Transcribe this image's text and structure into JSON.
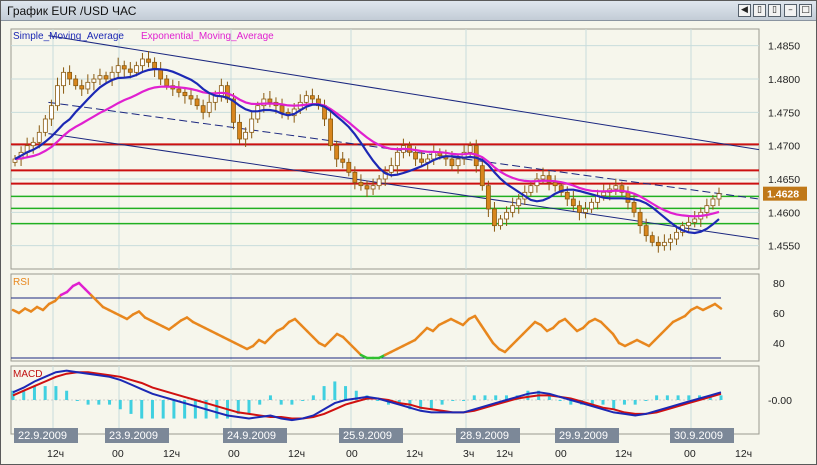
{
  "window": {
    "title": "График EUR /USD  ЧАС",
    "buttons": [
      "◀",
      "▯",
      "▯",
      "–",
      "□",
      "✕"
    ]
  },
  "colors": {
    "background": "#f6f6ec",
    "grid": "#c8dcdc",
    "candle_up": "#ffffff",
    "candle_down": "#d8861e",
    "candle_outline": "#8a5a10",
    "sma": "#1c28b4",
    "ema": "#e020d0",
    "channel": "#1c2880",
    "resistance": "#cc1010",
    "support": "#20b020",
    "rsi": "#e8871e",
    "rsi_overbought": "#e020d0",
    "rsi_oversold": "#30c030",
    "macd": "#1c28b4",
    "signal": "#d01010",
    "histogram": "#40d0e0",
    "price_tag": "#c07818",
    "date_label_bg": "#7c8898"
  },
  "chart_data": [
    {
      "type": "candlestick",
      "name": "EUR/USD hourly",
      "legend": [
        "Simple_Moving_Average",
        "Exponential_Moving_Average"
      ],
      "ylim": [
        1.4515,
        1.4875
      ],
      "y_ticks": [
        "1.4850",
        "1.4800",
        "1.4750",
        "1.4700",
        "1.4650",
        "1.4600",
        "1.4550"
      ],
      "current_price": "1.4628",
      "horizontal_lines": {
        "resistance": [
          1.4702,
          1.4663,
          1.4643
        ],
        "support": [
          1.4624,
          1.4606,
          1.4583
        ]
      },
      "trend_channel": {
        "upper": [
          [
            0.05,
            1.4865
          ],
          [
            1.0,
            1.4694
          ]
        ],
        "middle": [
          [
            0.05,
            1.4765
          ],
          [
            1.0,
            1.462
          ]
        ],
        "lower": [
          [
            0.05,
            1.4718
          ],
          [
            1.0,
            1.456
          ]
        ]
      },
      "close": [
        1.468,
        1.469,
        1.47,
        1.4705,
        1.472,
        1.474,
        1.476,
        1.479,
        1.481,
        1.48,
        1.479,
        1.4785,
        1.4795,
        1.48,
        1.4805,
        1.48,
        1.481,
        1.482,
        1.4815,
        1.481,
        1.482,
        1.483,
        1.4825,
        1.4815,
        1.48,
        1.479,
        1.4785,
        1.478,
        1.4775,
        1.477,
        1.476,
        1.475,
        1.4765,
        1.4775,
        1.479,
        1.477,
        1.4735,
        1.471,
        1.472,
        1.474,
        1.476,
        1.477,
        1.4765,
        1.476,
        1.475,
        1.4745,
        1.4755,
        1.4765,
        1.4775,
        1.477,
        1.476,
        1.474,
        1.47,
        1.468,
        1.4675,
        1.466,
        1.4645,
        1.464,
        1.4635,
        1.464,
        1.465,
        1.466,
        1.467,
        1.469,
        1.47,
        1.469,
        1.468,
        1.4675,
        1.468,
        1.469,
        1.4685,
        1.468,
        1.467,
        1.468,
        1.469,
        1.47,
        1.467,
        1.464,
        1.4605,
        1.458,
        1.459,
        1.46,
        1.461,
        1.462,
        1.463,
        1.464,
        1.465,
        1.4655,
        1.4645,
        1.464,
        1.463,
        1.462,
        1.461,
        1.46,
        1.4605,
        1.4615,
        1.4625,
        1.463,
        1.4635,
        1.464,
        1.463,
        1.4615,
        1.46,
        1.458,
        1.4565,
        1.4555,
        1.455,
        1.4555,
        1.456,
        1.457,
        1.458,
        1.4585,
        1.459,
        1.46,
        1.461,
        1.462,
        1.4628
      ]
    },
    {
      "type": "line",
      "name": "RSI",
      "ylim": [
        28,
        86
      ],
      "y_ticks": [
        "80",
        "60",
        "40"
      ],
      "levels": [
        70,
        30
      ],
      "values": [
        62,
        60,
        63,
        61,
        64,
        62,
        66,
        68,
        72,
        74,
        78,
        80,
        76,
        72,
        68,
        64,
        62,
        60,
        58,
        56,
        59,
        61,
        57,
        55,
        53,
        51,
        49,
        52,
        55,
        57,
        54,
        52,
        50,
        48,
        46,
        44,
        42,
        40,
        38,
        36,
        38,
        42,
        40,
        44,
        48,
        50,
        54,
        56,
        52,
        48,
        44,
        40,
        38,
        42,
        46,
        44,
        40,
        36,
        32,
        30,
        30,
        30,
        32,
        34,
        36,
        38,
        40,
        42,
        46,
        50,
        48,
        52,
        54,
        56,
        54,
        52,
        56,
        58,
        52,
        46,
        40,
        36,
        34,
        38,
        42,
        46,
        50,
        54,
        52,
        48,
        50,
        54,
        56,
        52,
        48,
        50,
        54,
        56,
        54,
        50,
        46,
        40,
        38,
        40,
        42,
        40,
        38,
        42,
        46,
        50,
        54,
        56,
        58,
        62,
        64,
        62,
        64,
        66,
        63
      ]
    },
    {
      "type": "line",
      "name": "MACD",
      "ylim": [
        -0.0022,
        0.0022
      ],
      "y_ticks": [
        "-0.00"
      ],
      "macd": [
        0.0005,
        0.0008,
        0.0012,
        0.0015,
        0.0018,
        0.0019,
        0.0018,
        0.0017,
        0.0016,
        0.0015,
        0.0013,
        0.001,
        0.0007,
        0.0004,
        0.0002,
        0.0,
        -0.0002,
        -0.0004,
        -0.0006,
        -0.0008,
        -0.001,
        -0.0011,
        -0.0012,
        -0.0011,
        -0.001,
        -0.0012,
        -0.0013,
        -0.0012,
        -0.001,
        -0.0006,
        -0.0002,
        0.0,
        0.0001,
        0.0002,
        0.0001,
        -0.0001,
        -0.0003,
        -0.0005,
        -0.0007,
        -0.0008,
        -0.0008,
        -0.0008,
        -0.0008,
        -0.0006,
        -0.0004,
        -0.0002,
        0.0,
        0.0002,
        0.0004,
        0.0005,
        0.0004,
        0.0002,
        0.0,
        -0.0002,
        -0.0004,
        -0.0006,
        -0.0008,
        -0.0009,
        -0.001,
        -0.0009,
        -0.0007,
        -0.0005,
        -0.0003,
        -0.0001,
        0.0001,
        0.0003,
        0.0005
      ],
      "signal": [
        0.0003,
        0.0006,
        0.0009,
        0.0012,
        0.0015,
        0.0017,
        0.0018,
        0.0018,
        0.0017,
        0.0016,
        0.0015,
        0.0013,
        0.0011,
        0.0008,
        0.0006,
        0.0004,
        0.0002,
        0.0,
        -0.0002,
        -0.0004,
        -0.0006,
        -0.0008,
        -0.0009,
        -0.001,
        -0.0011,
        -0.0011,
        -0.0012,
        -0.0012,
        -0.0011,
        -0.0009,
        -0.0006,
        -0.0003,
        -0.0001,
        0.0001,
        0.0001,
        0.0,
        -0.0002,
        -0.0003,
        -0.0005,
        -0.0006,
        -0.0007,
        -0.0008,
        -0.0008,
        -0.0007,
        -0.0005,
        -0.0003,
        -0.0001,
        0.0001,
        0.0002,
        0.0003,
        0.0003,
        0.0002,
        0.0001,
        -0.0001,
        -0.0003,
        -0.0005,
        -0.0006,
        -0.0008,
        -0.0009,
        -0.0009,
        -0.0008,
        -0.0006,
        -0.0004,
        -0.0002,
        0.0,
        0.0002,
        0.0004
      ]
    }
  ],
  "date_labels": [
    "22.9.2009",
    "23.9.2009",
    "24.9.2009",
    "25.9.2009",
    "28.9.2009",
    "29.9.2009",
    "30.9.2009"
  ],
  "hour_labels": [
    "12ч",
    "00",
    "12ч",
    "00",
    "12ч",
    "00",
    "12ч",
    "3ч",
    "12ч",
    "00",
    "12ч",
    "00",
    "12ч"
  ]
}
